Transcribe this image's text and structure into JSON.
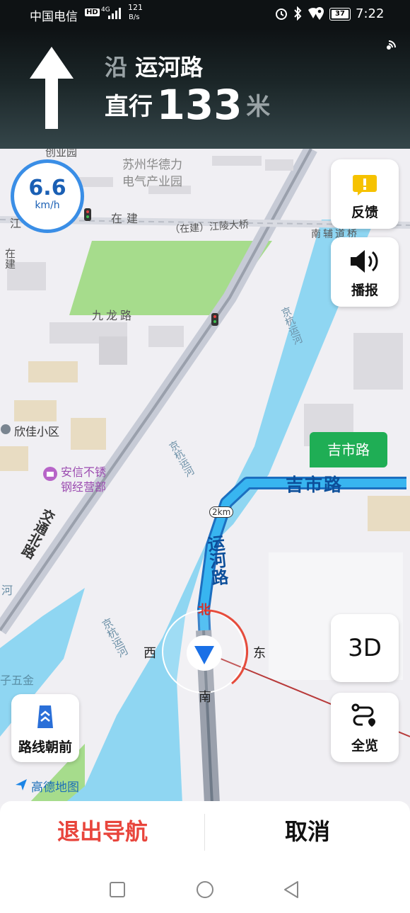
{
  "status_bar": {
    "carrier": "中国电信",
    "hd": "HD",
    "network": "4G",
    "speed_value": "121",
    "speed_unit": "B/s",
    "battery": "37",
    "time": "7:22"
  },
  "navigation": {
    "along_prefix": "沿",
    "road": "运河路",
    "action": "直行",
    "distance": "133",
    "distance_unit": "米"
  },
  "speed": {
    "value": "6.6",
    "unit": "km/h"
  },
  "buttons": {
    "feedback": "反馈",
    "broadcast": "播报",
    "three_d": "3D",
    "overview": "全览",
    "route_ahead": "路线朝前"
  },
  "map": {
    "labels": {
      "chuanggong": "创业园",
      "suzhou_line1": "苏州华德力",
      "suzhou_line2": "电气产业园",
      "jiang": "江",
      "zaijian": "在建",
      "jiangling": "（在建）江陵大桥",
      "nanfudao": "南辅道桥",
      "zaijian_v": "在建",
      "jiulong": "九龙路",
      "jinghang1": "京杭运河",
      "jinghang2": "京杭运河",
      "jinghang3": "京杭运河",
      "xinjia": "欣佳小区",
      "anxin1": "安信不锈",
      "anxin2": "钢经营部",
      "jiaotong": "交通北路",
      "zi_wujin": "子五金",
      "route_road": "吉市路",
      "yunhe": "运河路",
      "next_road_tag": "吉市路",
      "distance_marker": "2km",
      "river_left": "河",
      "brand": "高德地图"
    },
    "compass": {
      "north": "北",
      "south": "南",
      "east": "东",
      "west": "西"
    },
    "colors": {
      "water": "#8fd6f2",
      "green": "#a6dc8c",
      "route": "#29a7ea",
      "tag": "#1fae55"
    }
  },
  "bottom": {
    "exit": "退出导航",
    "cancel": "取消",
    "exit_color": "#e8453c"
  }
}
